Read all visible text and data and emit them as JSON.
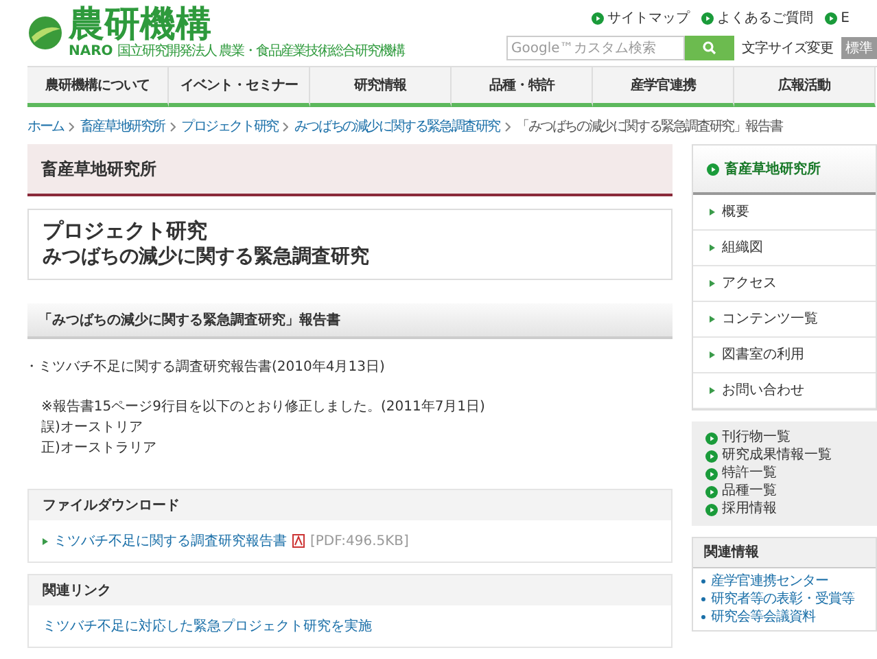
{
  "header": {
    "logo_text": "農研機構",
    "logo_sub": "NARO",
    "org_name": "国立研究開発法人 農業・食品産業技術総合研究機構",
    "top_links": [
      "サイトマップ",
      "よくあるご質問",
      "E"
    ],
    "search": {
      "placeholder": "Google™カスタム検索"
    },
    "font_size_label": "文字サイズ変更",
    "font_size_button": "標準"
  },
  "nav": [
    {
      "label": "農研機構について",
      "selected": false
    },
    {
      "label": "イベント・セミナー",
      "selected": false
    },
    {
      "label": "研究情報",
      "selected": false
    },
    {
      "label": "品種・特許",
      "selected": false
    },
    {
      "label": "産学官連携",
      "selected": false
    },
    {
      "label": "広報活動",
      "selected": false
    }
  ],
  "breadcrumb": [
    "ホーム",
    "畜産草地研究所",
    "プロジェクト研究",
    "みつばちの減少に関する緊急調査研究",
    "「みつばちの減少に関する緊急調査研究」報告書"
  ],
  "section_title": "畜産草地研究所",
  "page_title": [
    "プロジェクト研究",
    "みつばちの減少に関する緊急調査研究"
  ],
  "report_heading": "「みつばちの減少に関する緊急調査研究」報告書",
  "report_item": "・ミツバチ不足に関する調査研究報告書(2010年4月13日)",
  "correction": [
    "※報告書15ページ9行目を以下のとおり修正しました。(2011年7月1日)",
    "誤)オーストリア",
    "正)オーストラリア"
  ],
  "download": {
    "title": "ファイルダウンロード",
    "link": "ミツバチ不足に関する調査研究報告書",
    "meta": "[PDF:496.5KB]"
  },
  "related": {
    "title": "関連リンク",
    "link": "ミツバチ不足に対応した緊急プロジェクト研究を実施"
  },
  "sidebar": {
    "title": "畜産草地研究所",
    "items": [
      "概要",
      "組織図",
      "アクセス",
      "コンテンツ一覧",
      "図書室の利用",
      "お問い合わせ"
    ],
    "links": [
      "刊行物一覧",
      "研究成果情報一覧",
      "特許一覧",
      "品種一覧",
      "採用情報"
    ],
    "info_title": "関連情報",
    "info_items": [
      "産学官連携センター",
      "研究者等の表彰・受賞等",
      "研究会等会議資料"
    ]
  }
}
